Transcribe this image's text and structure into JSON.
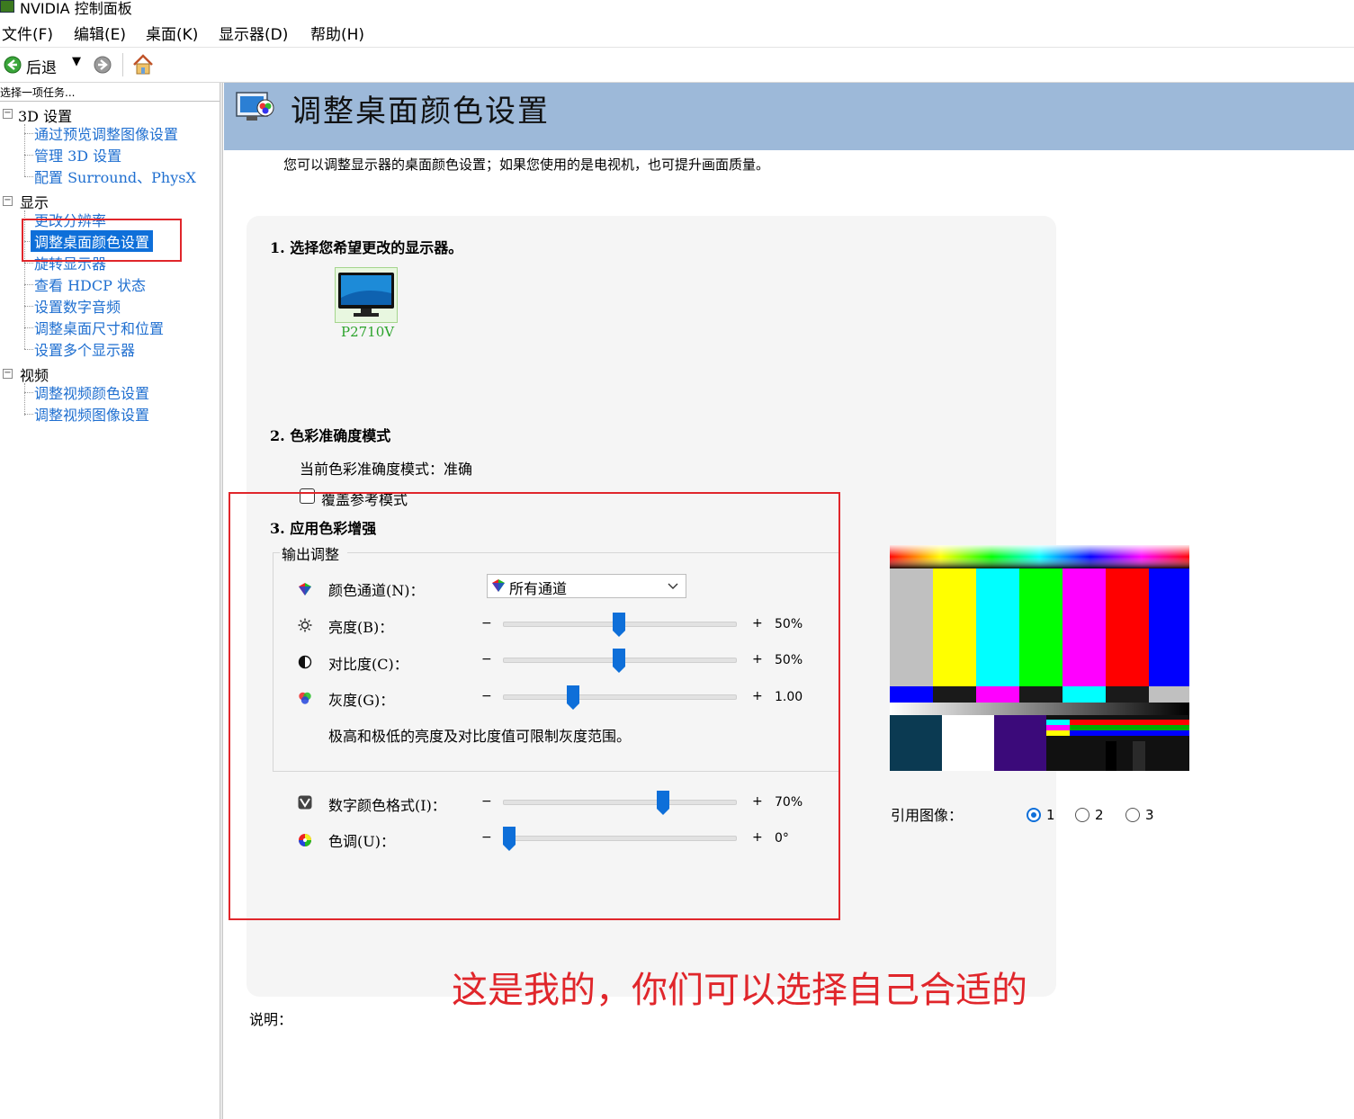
{
  "window": {
    "title": "NVIDIA 控制面板"
  },
  "menu": [
    {
      "label": "文件(F)"
    },
    {
      "label": "编辑(E)"
    },
    {
      "label": "桌面(K)"
    },
    {
      "label": "显示器(D)"
    },
    {
      "label": "帮助(H)"
    }
  ],
  "toolbar": {
    "back_label": "后退"
  },
  "sidebar": {
    "caption": "选择一项任务...",
    "categories": [
      {
        "label": "3D 设置",
        "items": [
          "通过预览调整图像设置",
          "管理 3D 设置",
          "配置 Surround、PhysX"
        ]
      },
      {
        "label": "显示",
        "items": [
          "更改分辨率",
          "调整桌面颜色设置",
          "旋转显示器",
          "查看 HDCP 状态",
          "设置数字音频",
          "调整桌面尺寸和位置",
          "设置多个显示器"
        ]
      },
      {
        "label": "视频",
        "items": [
          "调整视频颜色设置",
          "调整视频图像设置"
        ]
      }
    ],
    "selected_item": "调整桌面颜色设置"
  },
  "page": {
    "title": "调整桌面颜色设置",
    "description": "您可以调整显示器的桌面颜色设置；如果您使用的是电视机，也可提升画面质量。",
    "section1": {
      "title": "1.  选择您希望更改的显示器。",
      "monitor_name": "P2710V"
    },
    "section2": {
      "title": "2. 色彩准确度模式",
      "current_mode": "当前色彩准确度模式：准确",
      "override_label": "覆盖参考模式",
      "override_checked": false
    },
    "section3": {
      "title": "3. 应用色彩增强",
      "group_label": "输出调整",
      "channel_label": "颜色通道(N)：",
      "channel_value": "所有通道",
      "sliders": [
        {
          "name": "brightness",
          "label": "亮度(B)：",
          "value_text": "50%",
          "fraction": 0.5
        },
        {
          "name": "contrast",
          "label": "对比度(C)：",
          "value_text": "50%",
          "fraction": 0.5
        },
        {
          "name": "gamma",
          "label": "灰度(G)：",
          "value_text": "1.00",
          "fraction": 0.29
        }
      ],
      "note": "极高和极低的亮度及对比度值可限制灰度范围。",
      "sliders2": [
        {
          "name": "digital-vibrance",
          "label": "数字颜色格式(I)：",
          "value_text": "70%",
          "fraction": 0.7
        },
        {
          "name": "hue",
          "label": "色调(U)：",
          "value_text": "0°",
          "fraction": 0.0
        }
      ],
      "minus": "−",
      "plus": "+"
    },
    "reference": {
      "label": "引用图像：",
      "options": [
        "1",
        "2",
        "3"
      ],
      "selected": "1"
    },
    "explain_label": "说明："
  },
  "annotation": {
    "text": "这是我的，你们可以选择自己合适的",
    "color": "#e0262b"
  },
  "colors": {
    "banner": "#9db9d9",
    "link": "#1f6fd0",
    "selection": "#0e6fd9",
    "annotation_red": "#e0262b"
  }
}
